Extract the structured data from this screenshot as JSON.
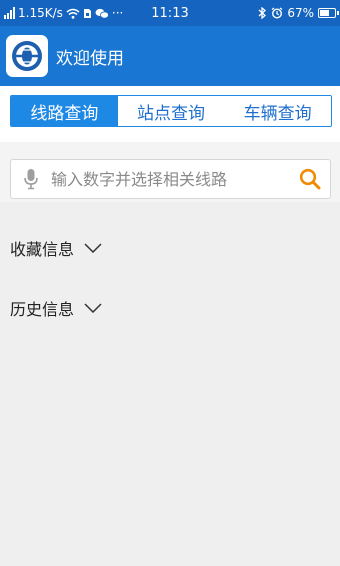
{
  "status_bar": {
    "net_speed": "1.15K/s",
    "more": "···",
    "time": "11:13",
    "battery": "67%",
    "battery_level": 0.67
  },
  "header": {
    "title": "欢迎使用"
  },
  "tabs": [
    {
      "label": "线路查询",
      "active": true
    },
    {
      "label": "站点查询",
      "active": false
    },
    {
      "label": "车辆查询",
      "active": false
    }
  ],
  "search": {
    "placeholder": "输入数字并选择相关线路",
    "value": ""
  },
  "sections": {
    "favorites": "收藏信息",
    "history": "历史信息"
  },
  "colors": {
    "status_bar": "#1565c0",
    "header": "#1976d2",
    "tab_active": "#1e88e5",
    "search_icon": "#f08a00",
    "background": "#efefef"
  }
}
